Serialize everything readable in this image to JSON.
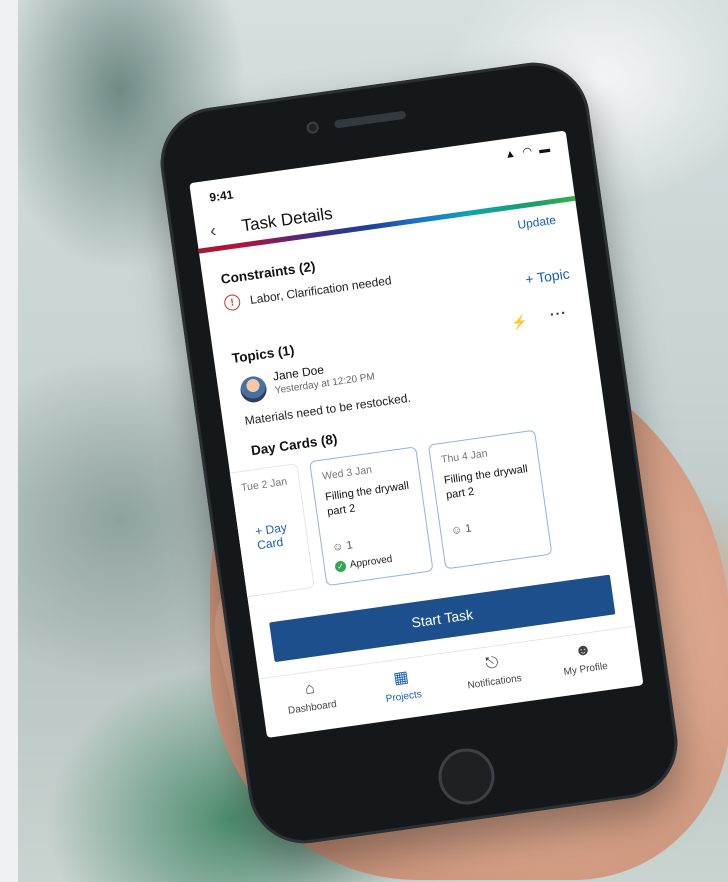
{
  "status_bar": {
    "time": "9:41",
    "signal_icons": "▲ ◠ ▬"
  },
  "header": {
    "back_icon": "back-chevron-icon",
    "title": "Task Details"
  },
  "actions": {
    "update": "Update"
  },
  "constraints": {
    "title": "Constraints (2)",
    "item": "Labor, Clarification needed"
  },
  "topics": {
    "add_label": "+ Topic",
    "title": "Topics (1)",
    "author": "Jane Doe",
    "timestamp": "Yesterday at 12:20 PM",
    "message": "Materials need to be restocked."
  },
  "day_cards": {
    "title": "Day Cards (8)",
    "add_label": "+ Day Card",
    "cards": [
      {
        "date": "Tue 2 Jan"
      },
      {
        "date": "Wed 3 Jan",
        "title": "Filling the drywall part 2",
        "people": "1",
        "status": "Approved"
      },
      {
        "date": "Thu 4 Jan",
        "title": "Filling the drywall part 2",
        "people": "1"
      }
    ]
  },
  "primary_button": {
    "label": "Start Task"
  },
  "tabs": [
    {
      "label": "Dashboard",
      "icon": "home-icon"
    },
    {
      "label": "Projects",
      "icon": "grid-icon"
    },
    {
      "label": "Notifications",
      "icon": "bell-icon"
    },
    {
      "label": "My Profile",
      "icon": "person-icon"
    }
  ],
  "colors": {
    "primary": "#1c4f8c",
    "link": "#1a5fb4",
    "danger": "#d0312d",
    "success": "#2fa84f"
  }
}
